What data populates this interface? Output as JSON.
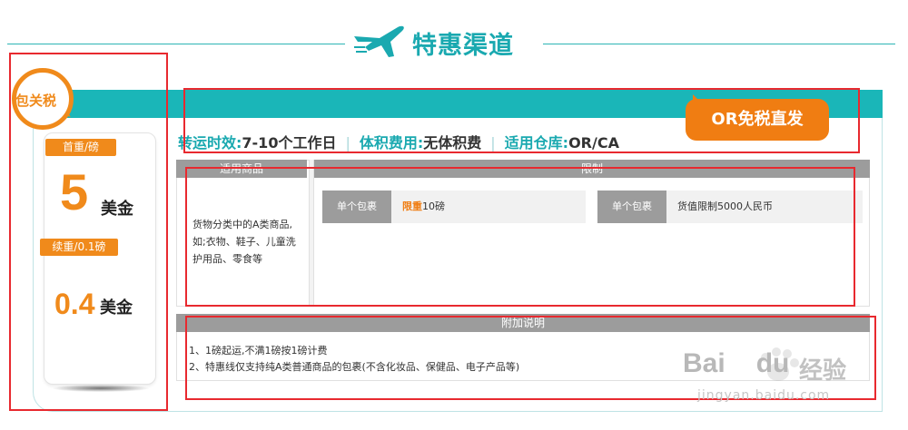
{
  "banner": {
    "title": "特惠渠道",
    "logo_icon": "airplane-icon",
    "accent": "#1aa9b0"
  },
  "badge": {
    "text": "包关税",
    "color": "#f08a1b"
  },
  "pricing": {
    "first_label": "首重/磅",
    "first_value": "5",
    "first_unit": "美金",
    "cont_label": "续重/0.1磅",
    "cont_value": "0.4",
    "cont_unit": "美金"
  },
  "promo": {
    "text": "OR免税直发",
    "color": "#f07d12"
  },
  "info": {
    "transit_label": "转运时效:",
    "transit_value": "7-10个工作日",
    "volume_label": "体积费用:",
    "volume_value": "无体积费",
    "warehouse_label": "适用仓库:",
    "warehouse_value": "OR/CA",
    "separator": "|"
  },
  "table": {
    "goods_header": "适用商品",
    "limit_header": "限制",
    "goods_text": "货物分类中的A类商品,如;衣物、鞋子、儿童洗护用品、零食等",
    "limits": [
      {
        "key": "单个包裹",
        "highlight": "限重",
        "value": "10磅"
      },
      {
        "key": "单个包裹",
        "highlight": "",
        "value": "货值限制5000人民币"
      }
    ]
  },
  "notes": {
    "header": "附加说明",
    "lines": [
      "1、1磅起运,不满1磅按1磅计费",
      "2、特惠线仅支持纯A类普通商品的包裹(不含化妆品、保健品、电子产品等)"
    ]
  },
  "watermark": {
    "brand": "Bai",
    "brand2": "du",
    "cn": "经验",
    "url": "jingyan.baidu.com"
  }
}
